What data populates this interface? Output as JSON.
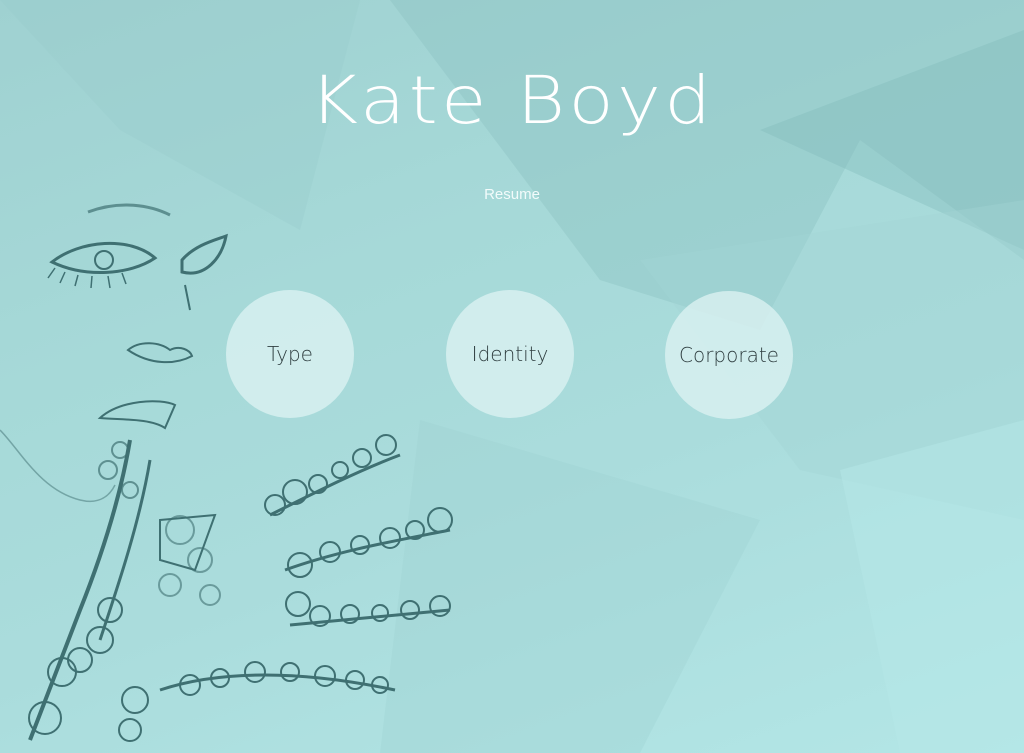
{
  "header": {
    "title": "Kate Boyd",
    "subtitle": "Resume"
  },
  "nav": {
    "items": [
      {
        "label": "Type"
      },
      {
        "label": "Identity"
      },
      {
        "label": "Corporate"
      }
    ]
  },
  "colors": {
    "background": "#a6d9d8",
    "circle": "#dcf2f2",
    "title": "#ffffff",
    "illustration": "#3f7072"
  }
}
